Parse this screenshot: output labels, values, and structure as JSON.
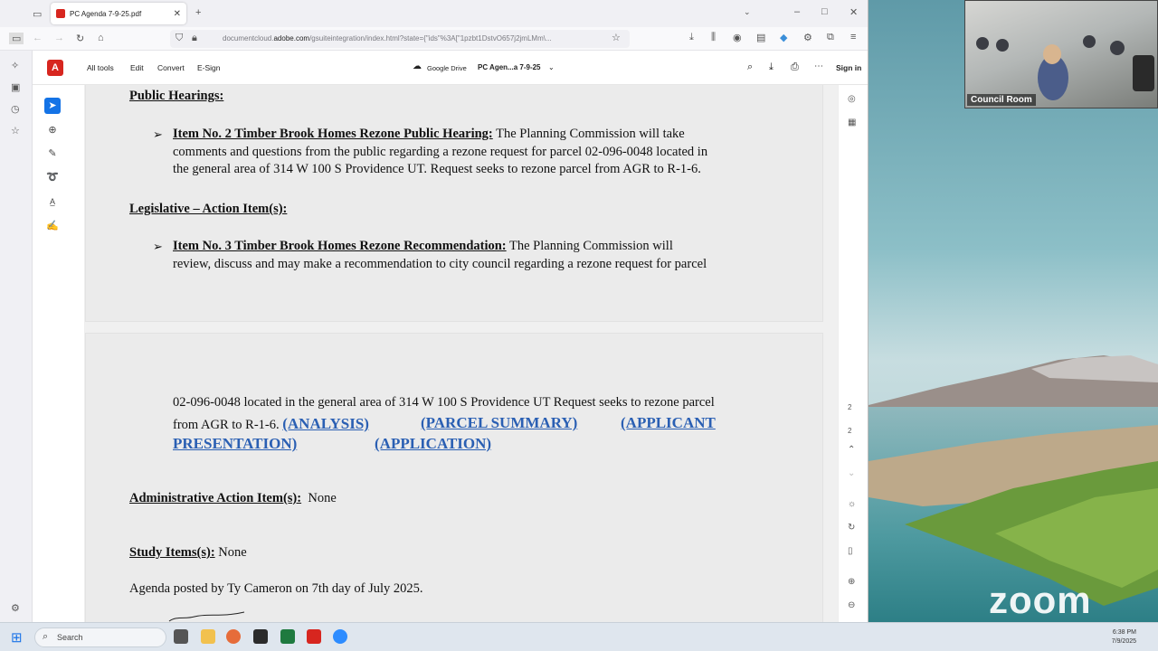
{
  "browser": {
    "tab_title": "PC Agenda 7-9-25.pdf",
    "url_prefix": "documentcloud.",
    "url_domain": "adobe.com",
    "url_rest": "/gsuiteintegration/index.html?state={\"ids\"%3A[\"1pzbt1DstvO657j2jmLMm\\..."
  },
  "acrobat": {
    "all_tools": "All tools",
    "edit": "Edit",
    "convert": "Convert",
    "esign": "E-Sign",
    "google_drive": "Google Drive",
    "doc_name": "PC Agen...a 7-9-25",
    "sign_in": "Sign in",
    "page_current": "2",
    "page_total": "2"
  },
  "document": {
    "public_hearings_heading": "Public Hearings:",
    "item2_title": "Item No.   2    Timber Brook Homes Rezone Public Hearing:",
    "item2_line1": " The Planning Commission will take",
    "item2_line2": "comments and questions from the public regarding a rezone request for parcel 02-096-0048 located in",
    "item2_line3": "the general area of 314 W 100 S Providence UT. Request seeks to rezone parcel from AGR to R-1-6.",
    "legislative_heading": "Legislative – Action Item(s):",
    "item3_title": "Item No.   3    Timber Brook Homes Rezone Recommendation:",
    "item3_line1": " The Planning Commission will",
    "item3_line2": "review, discuss and may make a recommendation to city council regarding a rezone request for parcel",
    "page2_line1": "02-096-0048 located in the general area of 314 W 100 S Providence UT Request seeks to rezone parcel",
    "page2_line2_text": "from AGR to R-1-6. ",
    "link_analysis": "(ANALYSIS)",
    "link_parcel_summary": "(PARCEL SUMMARY)",
    "link_applicant": "(APPLICANT",
    "link_presentation": "PRESENTATION)",
    "link_application": "(APPLICATION)",
    "admin_heading": "Administrative Action Item(s):",
    "admin_value": "None",
    "study_heading": "Study Items(s):",
    "study_value": "None",
    "posted_line": "Agenda posted by Ty Cameron  on    7th  day of   July  2025."
  },
  "zoom": {
    "video_label": "Council Room",
    "logo": "zoom"
  },
  "taskbar": {
    "search_placeholder": "Search",
    "time": "6:38 PM",
    "date": "7/9/2025"
  },
  "colors": {
    "link": "#2a5fb3",
    "acrobat_red": "#d7261f",
    "active_tool": "#1473e6"
  }
}
